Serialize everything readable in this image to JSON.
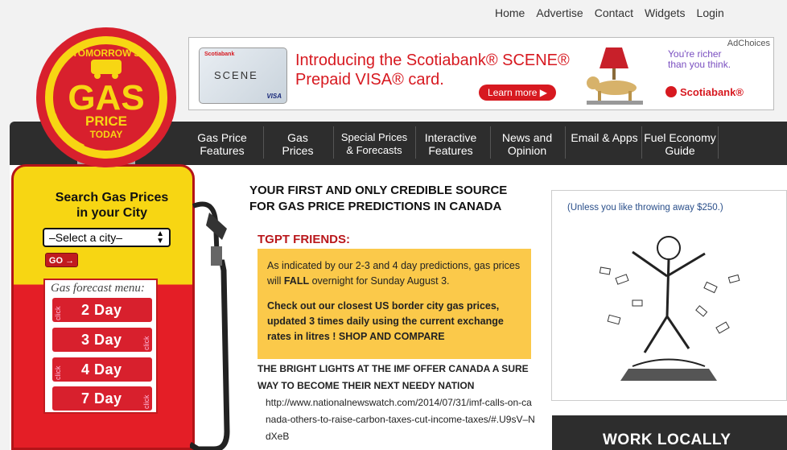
{
  "toplinks": [
    "Home",
    "Advertise",
    "Contact",
    "Widgets",
    "Login"
  ],
  "ad": {
    "adchoices": "AdChoices",
    "card_bank": "Scotiabank",
    "card_name": "SCENE",
    "card_network": "VISA",
    "headline_line1": "Introducing the Scotiabank® SCENE®",
    "headline_line2": "Prepaid VISA® card.",
    "learn_more": "Learn more ▶",
    "tagline_line1": "You're richer",
    "tagline_line2": "than you think.",
    "brand": "Scotiabank®"
  },
  "logo": {
    "top": "TOMORROW'S",
    "main": "GAS",
    "line3": "PRICE",
    "line4": "TODAY"
  },
  "nav": [
    {
      "line1": "Gas Price",
      "line2": "Features"
    },
    {
      "line1": "Gas",
      "line2": "Prices"
    },
    {
      "line1": "Special Prices",
      "line2": "& Forecasts"
    },
    {
      "line1": "Interactive",
      "line2": "Features"
    },
    {
      "line1": "News and",
      "line2": "Opinion"
    },
    {
      "line1": "Email & Apps",
      "line2": ""
    },
    {
      "line1": "Fuel Economy",
      "line2": "Guide"
    }
  ],
  "search": {
    "title_line1": "Search Gas Prices",
    "title_line2": "in your City",
    "select_value": "–Select a city–",
    "go_label": "GO →"
  },
  "forecast_menu": {
    "title": "Gas forecast menu:",
    "click_label": "click",
    "items": [
      "2 Day",
      "3 Day",
      "4 Day",
      "7 Day"
    ]
  },
  "main": {
    "headline_line1": "YOUR FIRST AND ONLY CREDIBLE SOURCE",
    "headline_line2": "FOR GAS PRICE PREDICTIONS IN CANADA",
    "friends": "TGPT FRIENDS:",
    "notice_p1_a": "As indicated by our 2-3 and 4 day predictions, gas prices will ",
    "notice_p1_b": "FALL",
    "notice_p1_c": " overnight for Sunday August 3.",
    "notice_p2": "Check out our closest US border city  gas prices, updated 3 times daily using the current exchange rates in litres ! SHOP AND COMPARE",
    "news_title": "THE BRIGHT LIGHTS AT THE IMF OFFER CANADA A SURE WAY TO BECOME THEIR NEXT NEEDY NATION",
    "news_url": "http://www.nationalnewswatch.com/2014/07/31/imf-calls-on-canada-others-to-raise-carbon-taxes-cut-income-taxes/#.U9sV–NdXeB"
  },
  "right_ad": {
    "caption": "(Unless you like throwing away $250.)"
  },
  "work_locally": "WORK LOCALLY"
}
